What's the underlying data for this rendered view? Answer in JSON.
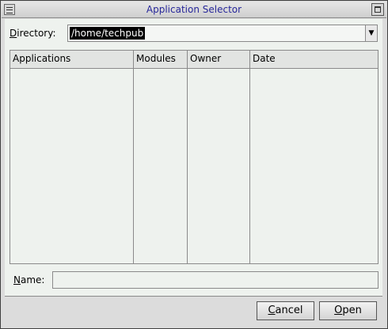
{
  "window": {
    "title": "Application Selector"
  },
  "directory": {
    "label_mnemonic": "D",
    "label_rest": "irectory:",
    "value": "/home/techpub"
  },
  "table": {
    "columns": [
      "Applications",
      "Modules",
      "Owner",
      "Date"
    ],
    "rows": []
  },
  "name": {
    "label_mnemonic": "N",
    "label_rest": "ame:",
    "value": ""
  },
  "buttons": {
    "cancel_mnemonic": "C",
    "cancel_rest": "ancel",
    "open_mnemonic": "O",
    "open_rest": "pen"
  },
  "colors": {
    "title_text": "#27279a",
    "panel": "#eef2ee",
    "selection": "#000000"
  }
}
